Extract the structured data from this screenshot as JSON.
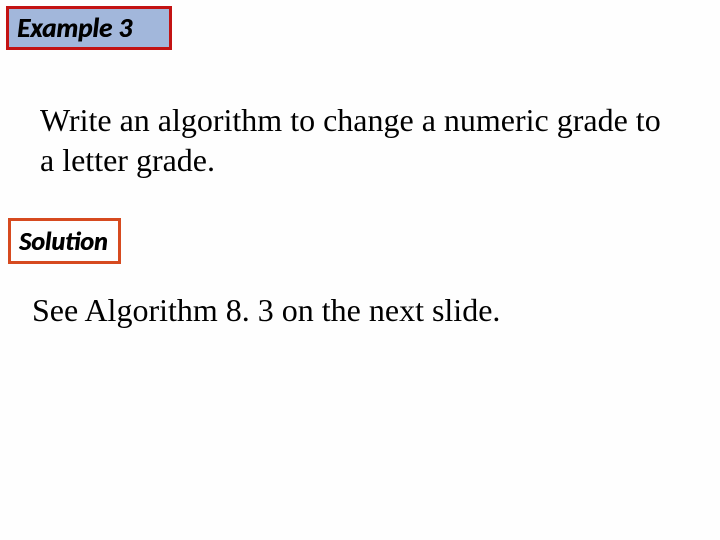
{
  "example_badge": {
    "label": "Example 3"
  },
  "problem": {
    "text": "Write an algorithm to change a numeric grade to a letter grade."
  },
  "solution_badge": {
    "label": "Solution"
  },
  "solution_body": {
    "text": "See Algorithm 8. 3 on the next slide."
  }
}
